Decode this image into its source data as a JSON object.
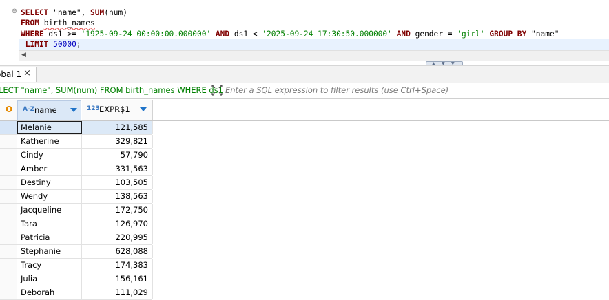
{
  "editor": {
    "fold_marker": "⊖",
    "lines": [
      {
        "parts": [
          [
            "kw",
            "SELECT "
          ],
          [
            "ident",
            "\"name\", "
          ],
          [
            "kw",
            "SUM"
          ],
          [
            "ident",
            "(num)"
          ]
        ]
      },
      {
        "parts": [
          [
            "kw",
            "FROM "
          ],
          [
            "squiggle",
            "birth_names"
          ]
        ]
      },
      {
        "parts": [
          [
            "kw",
            "WHERE "
          ],
          [
            "ident",
            "ds1 >= "
          ],
          [
            "str",
            "'1925-09-24 00:00:00.000000'"
          ],
          [
            "ident",
            " "
          ],
          [
            "kw",
            "AND "
          ],
          [
            "ident",
            "ds1 < "
          ],
          [
            "str",
            "'2025-09-24 17:30:50.000000'"
          ],
          [
            "ident",
            " "
          ],
          [
            "kw",
            "AND "
          ],
          [
            "ident",
            "gender = "
          ],
          [
            "str",
            "'girl'"
          ],
          [
            "ident",
            " "
          ],
          [
            "kw",
            "GROUP BY "
          ],
          [
            "ident",
            "\"name\""
          ]
        ]
      },
      {
        "parts": [
          [
            "kw",
            " LIMIT "
          ],
          [
            "num",
            "50000"
          ],
          [
            "ident",
            ";"
          ]
        ],
        "current": true
      }
    ]
  },
  "results_tab": {
    "label": "obal 1",
    "close_glyph": "×"
  },
  "filter": {
    "query_preview": "LECT \"name\", SUM(num) FROM birth_names WHERE ds1",
    "placeholder": "Enter a SQL expression to filter results (use Ctrl+Space)"
  },
  "grid": {
    "rownum_header": "O",
    "columns": [
      {
        "type_badge": "A-Z",
        "title": "name"
      },
      {
        "type_badge": "123",
        "title": "EXPR$1"
      }
    ],
    "rows": [
      {
        "name": "Melanie",
        "value": "121,585"
      },
      {
        "name": "Katherine",
        "value": "329,821"
      },
      {
        "name": "Cindy",
        "value": "57,790"
      },
      {
        "name": "Amber",
        "value": "331,563"
      },
      {
        "name": "Destiny",
        "value": "103,505"
      },
      {
        "name": "Wendy",
        "value": "138,563"
      },
      {
        "name": "Jacqueline",
        "value": "172,750"
      },
      {
        "name": "Tara",
        "value": "126,970"
      },
      {
        "name": "Patricia",
        "value": "220,995"
      },
      {
        "name": "Stephanie",
        "value": "628,088"
      },
      {
        "name": "Tracy",
        "value": "174,383"
      },
      {
        "name": "Julia",
        "value": "156,161"
      },
      {
        "name": "Deborah",
        "value": "111,029"
      }
    ]
  },
  "colors": {
    "keyword": "#7f0000",
    "string": "#008000",
    "number": "#0000c0",
    "selection": "#dce9f7",
    "accent": "#1f73c8"
  }
}
